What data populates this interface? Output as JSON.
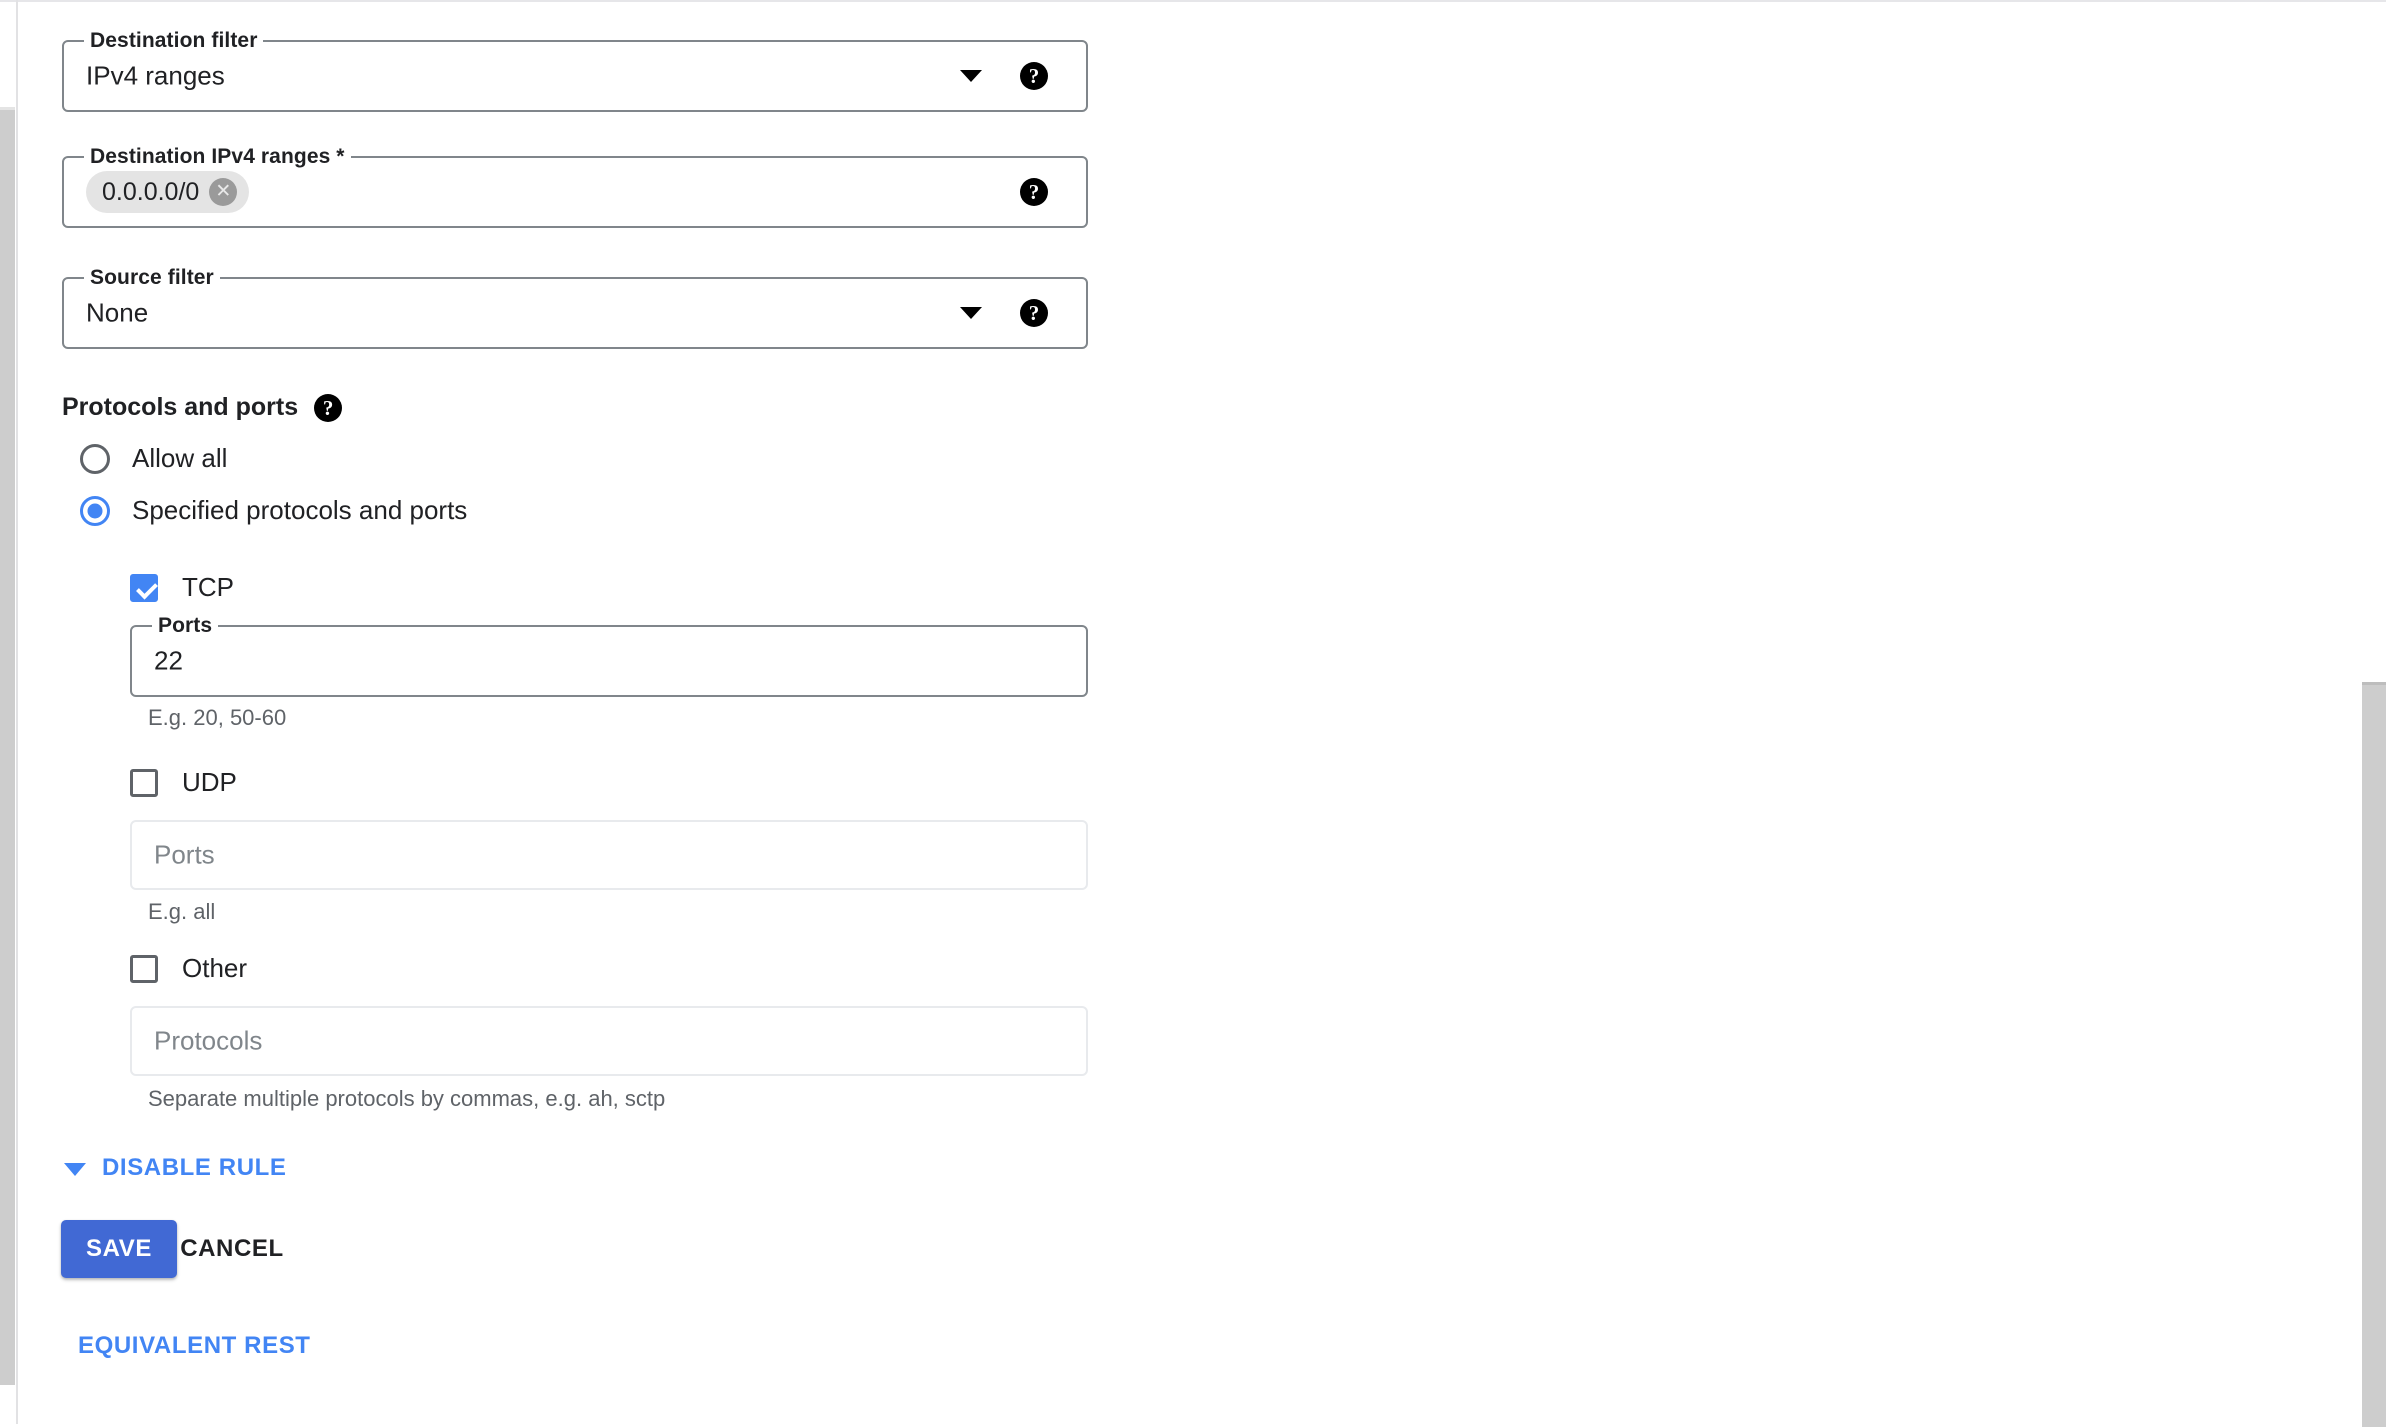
{
  "form": {
    "destination_filter": {
      "legend": "Destination filter",
      "value": "IPv4 ranges",
      "caret_icon": "chevron-down-icon",
      "help_icon": "help-icon",
      "help_glyph": "?"
    },
    "destination_ranges": {
      "legend": "Destination IPv4 ranges *",
      "chips": [
        {
          "label": "0.0.0.0/0",
          "remove_glyph": "✕"
        }
      ],
      "help_icon": "help-icon",
      "help_glyph": "?"
    },
    "source_filter": {
      "legend": "Source filter",
      "value": "None",
      "caret_icon": "chevron-down-icon",
      "help_icon": "help-icon",
      "help_glyph": "?"
    },
    "protocols_section": {
      "title": "Protocols and ports",
      "help_glyph": "?",
      "radios": [
        {
          "label": "Allow all",
          "checked": false
        },
        {
          "label": "Specified protocols and ports",
          "checked": true
        }
      ],
      "tcp": {
        "label": "TCP",
        "checked": true,
        "ports_legend": "Ports",
        "ports_value": "22",
        "hint": "E.g. 20, 50-60"
      },
      "udp": {
        "label": "UDP",
        "checked": false,
        "ports_placeholder": "Ports",
        "hint": "E.g. all"
      },
      "other": {
        "label": "Other",
        "checked": false,
        "protocols_placeholder": "Protocols",
        "hint": "Separate multiple protocols by commas, e.g. ah, sctp"
      }
    },
    "disable_rule": {
      "label": "DISABLE RULE",
      "chevron_icon": "chevron-down-icon"
    },
    "actions": {
      "save_label": "SAVE",
      "cancel_label": "CANCEL",
      "equivalent_rest_label": "EQUIVALENT REST"
    }
  },
  "colors": {
    "accent_blue": "#4285f4",
    "save_button": "#4169d4",
    "field_border": "#80868b",
    "hint_text": "#5f6368",
    "chip_bg": "#e4e4e4",
    "scrollbar_thumb": "#cdcdcd"
  }
}
